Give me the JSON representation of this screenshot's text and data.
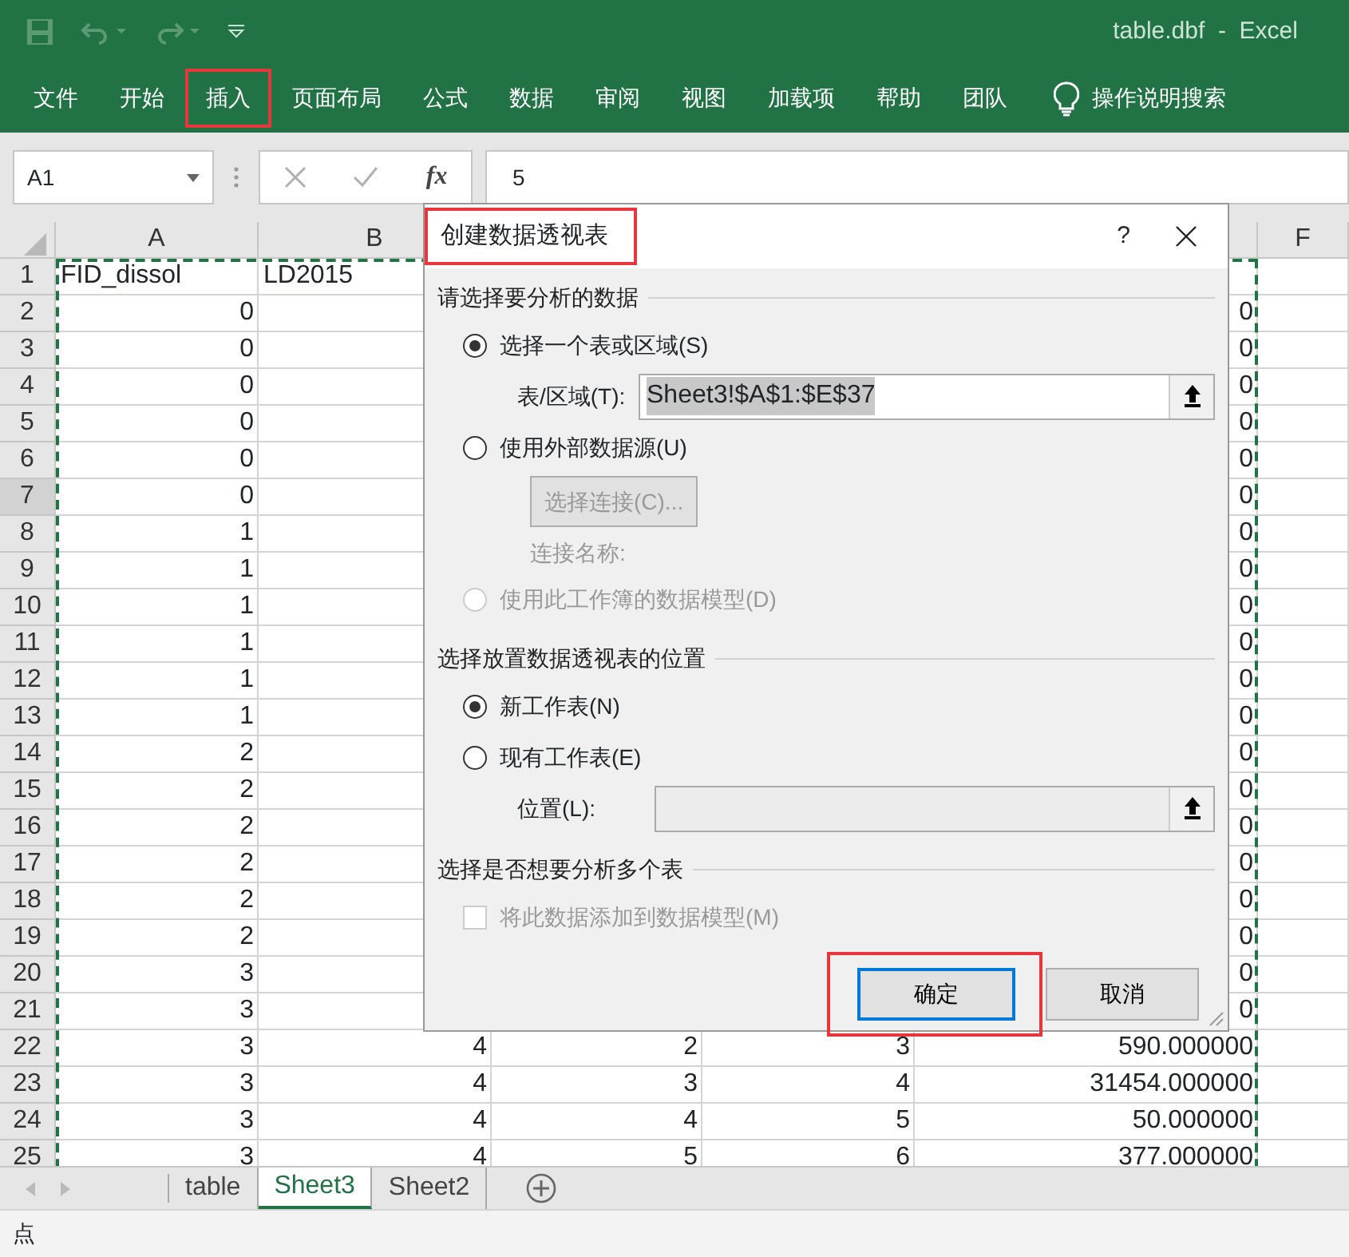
{
  "window": {
    "title": "table.dbf  -  Excel"
  },
  "ribbon_tabs": [
    {
      "label": "文件",
      "annotated": false
    },
    {
      "label": "开始",
      "annotated": false
    },
    {
      "label": "插入",
      "annotated": true
    },
    {
      "label": "页面布局",
      "annotated": false
    },
    {
      "label": "公式",
      "annotated": false
    },
    {
      "label": "数据",
      "annotated": false
    },
    {
      "label": "审阅",
      "annotated": false
    },
    {
      "label": "视图",
      "annotated": false
    },
    {
      "label": "加载项",
      "annotated": false
    },
    {
      "label": "帮助",
      "annotated": false
    },
    {
      "label": "团队",
      "annotated": false
    }
  ],
  "tell_me": "操作说明搜索",
  "formula_bar": {
    "name_box": "A1",
    "fx": "fx",
    "value": "5"
  },
  "column_headers": {
    "A": "A",
    "B": "B",
    "F": "F"
  },
  "rows": [
    {
      "num": "1",
      "selected": false,
      "cells": {
        "A": "FID_dissol",
        "B": "LD2015"
      }
    },
    {
      "num": "2",
      "selected": false,
      "cells": {
        "A": "0",
        "E": "0"
      }
    },
    {
      "num": "3",
      "selected": false,
      "cells": {
        "A": "0",
        "E": "0"
      }
    },
    {
      "num": "4",
      "selected": false,
      "cells": {
        "A": "0",
        "E": "0"
      }
    },
    {
      "num": "5",
      "selected": false,
      "cells": {
        "A": "0",
        "E": "0"
      }
    },
    {
      "num": "6",
      "selected": false,
      "cells": {
        "A": "0",
        "E": "0"
      }
    },
    {
      "num": "7",
      "selected": true,
      "cells": {
        "A": "0",
        "E": "0"
      }
    },
    {
      "num": "8",
      "selected": false,
      "cells": {
        "A": "1",
        "E": "0"
      }
    },
    {
      "num": "9",
      "selected": false,
      "cells": {
        "A": "1",
        "E": "0"
      }
    },
    {
      "num": "10",
      "selected": false,
      "cells": {
        "A": "1",
        "E": "0"
      }
    },
    {
      "num": "11",
      "selected": false,
      "cells": {
        "A": "1",
        "E": "0"
      }
    },
    {
      "num": "12",
      "selected": false,
      "cells": {
        "A": "1",
        "E": "0"
      }
    },
    {
      "num": "13",
      "selected": false,
      "cells": {
        "A": "1",
        "E": "0"
      }
    },
    {
      "num": "14",
      "selected": false,
      "cells": {
        "A": "2",
        "E": "0"
      }
    },
    {
      "num": "15",
      "selected": false,
      "cells": {
        "A": "2",
        "E": "0"
      }
    },
    {
      "num": "16",
      "selected": false,
      "cells": {
        "A": "2",
        "E": "0"
      }
    },
    {
      "num": "17",
      "selected": false,
      "cells": {
        "A": "2",
        "E": "0"
      }
    },
    {
      "num": "18",
      "selected": false,
      "cells": {
        "A": "2",
        "E": "0"
      }
    },
    {
      "num": "19",
      "selected": false,
      "cells": {
        "A": "2",
        "E": "0"
      }
    },
    {
      "num": "20",
      "selected": false,
      "cells": {
        "A": "3",
        "E": "0"
      }
    },
    {
      "num": "21",
      "selected": false,
      "cells": {
        "A": "3",
        "E": "0"
      }
    },
    {
      "num": "22",
      "selected": false,
      "cells": {
        "A": "3",
        "B": "4",
        "C": "2",
        "D": "3",
        "E": "590.000000"
      }
    },
    {
      "num": "23",
      "selected": false,
      "cells": {
        "A": "3",
        "B": "4",
        "C": "3",
        "D": "4",
        "E": "31454.000000"
      }
    },
    {
      "num": "24",
      "selected": false,
      "cells": {
        "A": "3",
        "B": "4",
        "C": "4",
        "D": "5",
        "E": "50.000000"
      }
    },
    {
      "num": "25",
      "selected": false,
      "cells": {
        "A": "3",
        "B": "4",
        "C": "5",
        "D": "6",
        "E": "377.000000"
      }
    }
  ],
  "sheet_tabs": [
    {
      "label": "table",
      "selected": false
    },
    {
      "label": "Sheet3",
      "selected": true
    },
    {
      "label": "Sheet2",
      "selected": false
    }
  ],
  "status_bar": "点",
  "dialog": {
    "title": "创建数据透视表",
    "title_annotated": true,
    "help": "?",
    "sections": [
      {
        "heading": "请选择要分析的数据",
        "items": [
          {
            "kind": "radio",
            "label": "选择一个表或区域(S)",
            "checked": true,
            "disabled": false
          },
          {
            "kind": "field",
            "label": "表/区域(T):",
            "value": "Sheet3!$A$1:$E$37",
            "disabled": false
          },
          {
            "kind": "radio",
            "label": "使用外部数据源(U)",
            "checked": false,
            "disabled": false
          },
          {
            "kind": "button",
            "label": "选择连接(C)...",
            "disabled": true
          },
          {
            "kind": "note",
            "label": "连接名称:",
            "disabled": true
          },
          {
            "kind": "radio",
            "label": "使用此工作簿的数据模型(D)",
            "checked": false,
            "disabled": true
          }
        ]
      },
      {
        "heading": "选择放置数据透视表的位置",
        "items": [
          {
            "kind": "radio",
            "label": "新工作表(N)",
            "checked": true,
            "disabled": false
          },
          {
            "kind": "radio",
            "label": "现有工作表(E)",
            "checked": false,
            "disabled": false
          },
          {
            "kind": "field",
            "label": "位置(L):",
            "disabled": true
          }
        ]
      },
      {
        "heading": "选择是否想要分析多个表",
        "items": [
          {
            "kind": "checkbox",
            "label": "将此数据添加到数据模型(M)",
            "checked": false,
            "disabled": true
          }
        ]
      }
    ],
    "buttons": [
      {
        "label": "确定",
        "default": true,
        "annotated": true
      },
      {
        "label": "取消",
        "default": false,
        "annotated": false
      }
    ]
  }
}
